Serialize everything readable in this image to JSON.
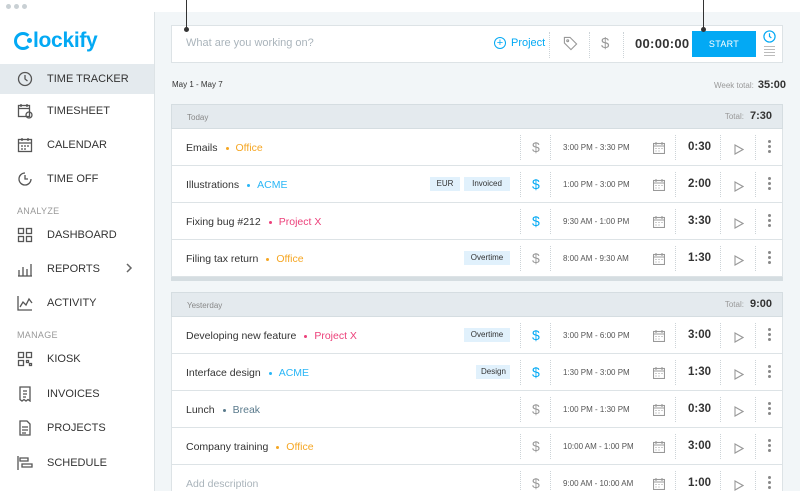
{
  "app": {
    "logo_text": "lockify",
    "brand_color": "#03a9f4"
  },
  "sidebar": {
    "items": [
      {
        "label": "TIME TRACKER",
        "icon": "clock-icon",
        "active": true
      },
      {
        "label": "TIMESHEET",
        "icon": "timesheet-icon"
      },
      {
        "label": "CALENDAR",
        "icon": "calendar-icon"
      },
      {
        "label": "TIME OFF",
        "icon": "time-off-icon"
      }
    ],
    "analyze_label": "ANALYZE",
    "analyze_items": [
      {
        "label": "DASHBOARD",
        "icon": "dashboard-icon"
      },
      {
        "label": "REPORTS",
        "icon": "reports-icon"
      },
      {
        "label": "ACTIVITY",
        "icon": "activity-icon"
      }
    ],
    "manage_label": "MANAGE",
    "manage_items": [
      {
        "label": "KIOSK",
        "icon": "kiosk-icon"
      },
      {
        "label": "INVOICES",
        "icon": "invoices-icon"
      },
      {
        "label": "PROJECTS",
        "icon": "projects-icon"
      },
      {
        "label": "SCHEDULE",
        "icon": "schedule-icon"
      }
    ]
  },
  "tracker": {
    "placeholder": "What are you working on?",
    "project_label": "Project",
    "dollar": "$",
    "timer": "00:00:00",
    "start_label": "START"
  },
  "week": {
    "range": "May 1 - May 7",
    "total_label": "Week total:",
    "total": "35:00"
  },
  "days": [
    {
      "label": "Today",
      "total_label": "Total:",
      "total": "7:30",
      "entries": [
        {
          "desc": "Emails",
          "project": "Office",
          "project_color": "#f5a623",
          "badges": [],
          "billable": false,
          "range": "3:00 PM - 3:30 PM",
          "duration": "0:30"
        },
        {
          "desc": "Illustrations",
          "project": "ACME",
          "project_color": "#29b6f6",
          "badges": [
            "EUR",
            "Invoiced"
          ],
          "billable": true,
          "range": "1:00 PM - 3:00 PM",
          "duration": "2:00"
        },
        {
          "desc": "Fixing bug #212",
          "project": "Project X",
          "project_color": "#ec407a",
          "badges": [],
          "billable": true,
          "range": "9:30 AM - 1:00 PM",
          "duration": "3:30"
        },
        {
          "desc": "Filing tax return",
          "project": "Office",
          "project_color": "#f5a623",
          "badges": [
            "Overtime"
          ],
          "billable": false,
          "range": "8:00 AM - 9:30 AM",
          "duration": "1:30"
        }
      ]
    },
    {
      "label": "Yesterday",
      "total_label": "Total:",
      "total": "9:00",
      "entries": [
        {
          "desc": "Developing new feature",
          "project": "Project X",
          "project_color": "#ec407a",
          "badges": [
            "Overtime"
          ],
          "billable": true,
          "range": "3:00 PM - 6:00 PM",
          "duration": "3:00"
        },
        {
          "desc": "Interface design",
          "project": "ACME",
          "project_color": "#29b6f6",
          "badges": [
            "Design"
          ],
          "billable": true,
          "range": "1:30 PM - 3:00 PM",
          "duration": "1:30"
        },
        {
          "desc": "Lunch",
          "project": "Break",
          "project_color": "#5a7a8c",
          "badges": [],
          "billable": false,
          "range": "1:00 PM - 1:30 PM",
          "duration": "0:30"
        },
        {
          "desc": "Company training",
          "project": "Office",
          "project_color": "#f5a623",
          "badges": [],
          "billable": false,
          "range": "10:00 AM - 1:00 PM",
          "duration": "3:00"
        },
        {
          "desc": "Add description",
          "project": "",
          "project_color": "",
          "badges": [],
          "billable": false,
          "range": "9:00 AM - 10:00 AM",
          "duration": "1:00",
          "placeholder": true
        }
      ]
    }
  ]
}
